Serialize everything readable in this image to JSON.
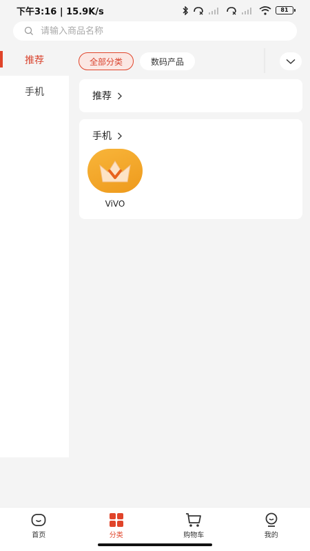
{
  "status_bar": {
    "time_speed": "下午3:16 | 15.9K/s",
    "battery": "81"
  },
  "search": {
    "placeholder": "请输入商品名称",
    "value": ""
  },
  "sidebar": {
    "items": [
      {
        "label": "推荐",
        "active": true
      },
      {
        "label": "手机",
        "active": false
      }
    ]
  },
  "chips": [
    {
      "label": "全部分类",
      "active": true
    },
    {
      "label": "数码产品",
      "active": false
    }
  ],
  "sections": [
    {
      "title": "推荐",
      "products": []
    },
    {
      "title": "手机",
      "products": [
        {
          "name": "ViVO",
          "logo": "vivo-crown-logo"
        }
      ]
    }
  ],
  "bottom_nav": [
    {
      "label": "首页",
      "icon": "home-icon",
      "active": false
    },
    {
      "label": "分类",
      "icon": "category-icon",
      "active": true
    },
    {
      "label": "购物车",
      "icon": "cart-icon",
      "active": false
    },
    {
      "label": "我的",
      "icon": "profile-icon",
      "active": false
    }
  ],
  "colors": {
    "accent": "#e0442a",
    "background": "#f4f4f4",
    "product_logo": "#f3a72b"
  }
}
